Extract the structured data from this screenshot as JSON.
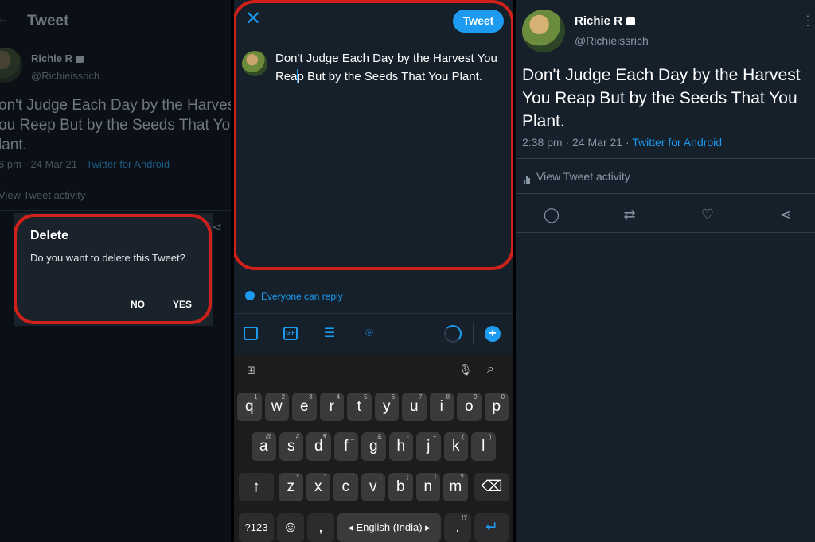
{
  "left_screen": {
    "header_title": "Tweet",
    "tweet": {
      "author_name": "Richie R",
      "author_handle": "@Richieissrich",
      "text_lines": [
        "on't Judge Each Day by the Harvest",
        "ou Reep But by the Seeds That You",
        "lant."
      ],
      "time": "6 pm · 24 Mar 21 · ",
      "source": "Twitter for Android",
      "activity_label": "View Tweet activity"
    },
    "dialog": {
      "title": "Delete",
      "message": "Do you want to delete this Tweet?",
      "no_label": "NO",
      "yes_label": "YES"
    }
  },
  "compose_screen": {
    "close_icon": "close-icon",
    "tweet_button_label": "Tweet",
    "draft_before_caret": "Don't Judge Each Day by the Harvest You Rea",
    "draft_after_caret": "p But by the Seeds That You Plant.",
    "reply_setting": "Everyone can reply",
    "toolbar": {
      "gif_label": "GIF",
      "add_label": "+"
    },
    "keyboard": {
      "row1": [
        {
          "key": "q",
          "hint": "1"
        },
        {
          "key": "w",
          "hint": "2"
        },
        {
          "key": "e",
          "hint": "3"
        },
        {
          "key": "r",
          "hint": "4"
        },
        {
          "key": "t",
          "hint": "5"
        },
        {
          "key": "y",
          "hint": "6"
        },
        {
          "key": "u",
          "hint": "7"
        },
        {
          "key": "i",
          "hint": "8"
        },
        {
          "key": "o",
          "hint": "9"
        },
        {
          "key": "p",
          "hint": "0"
        }
      ],
      "row2": [
        {
          "key": "a",
          "hint": "@"
        },
        {
          "key": "s",
          "hint": "#"
        },
        {
          "key": "d",
          "hint": "₹"
        },
        {
          "key": "f",
          "hint": "_"
        },
        {
          "key": "g",
          "hint": "&"
        },
        {
          "key": "h",
          "hint": "-"
        },
        {
          "key": "j",
          "hint": "+"
        },
        {
          "key": "k",
          "hint": "("
        },
        {
          "key": "l",
          "hint": ")"
        }
      ],
      "row3": [
        {
          "key": "z",
          "hint": "*"
        },
        {
          "key": "x",
          "hint": "\""
        },
        {
          "key": "c",
          "hint": "'"
        },
        {
          "key": "v",
          "hint": ":"
        },
        {
          "key": "b",
          "hint": ";"
        },
        {
          "key": "n",
          "hint": "!"
        },
        {
          "key": "m",
          "hint": "?"
        }
      ],
      "shift_key": "↑",
      "backspace_key": "⌫",
      "symbols_key": "?123",
      "emoji_key": "☺",
      "comma_key": ",",
      "space_label": "◂ English (India) ▸",
      "period_key": ".",
      "period_hint": "!?",
      "enter_key": "↵"
    }
  },
  "right_screen": {
    "author_name": "Richie R",
    "author_handle": "@Richieissrich",
    "text": "Don't Judge Each Day by the Harvest You Reap But by the Seeds That You Plant.",
    "time": "2:38 pm · 24 Mar 21 · ",
    "source": "Twitter for Android",
    "activity_label": "View Tweet activity",
    "actions": [
      "reply-icon",
      "retweet-icon",
      "like-icon",
      "share-icon"
    ]
  },
  "colors": {
    "accent": "#1d9bf0",
    "background": "#15202b",
    "highlight_ring": "#d0201a"
  }
}
